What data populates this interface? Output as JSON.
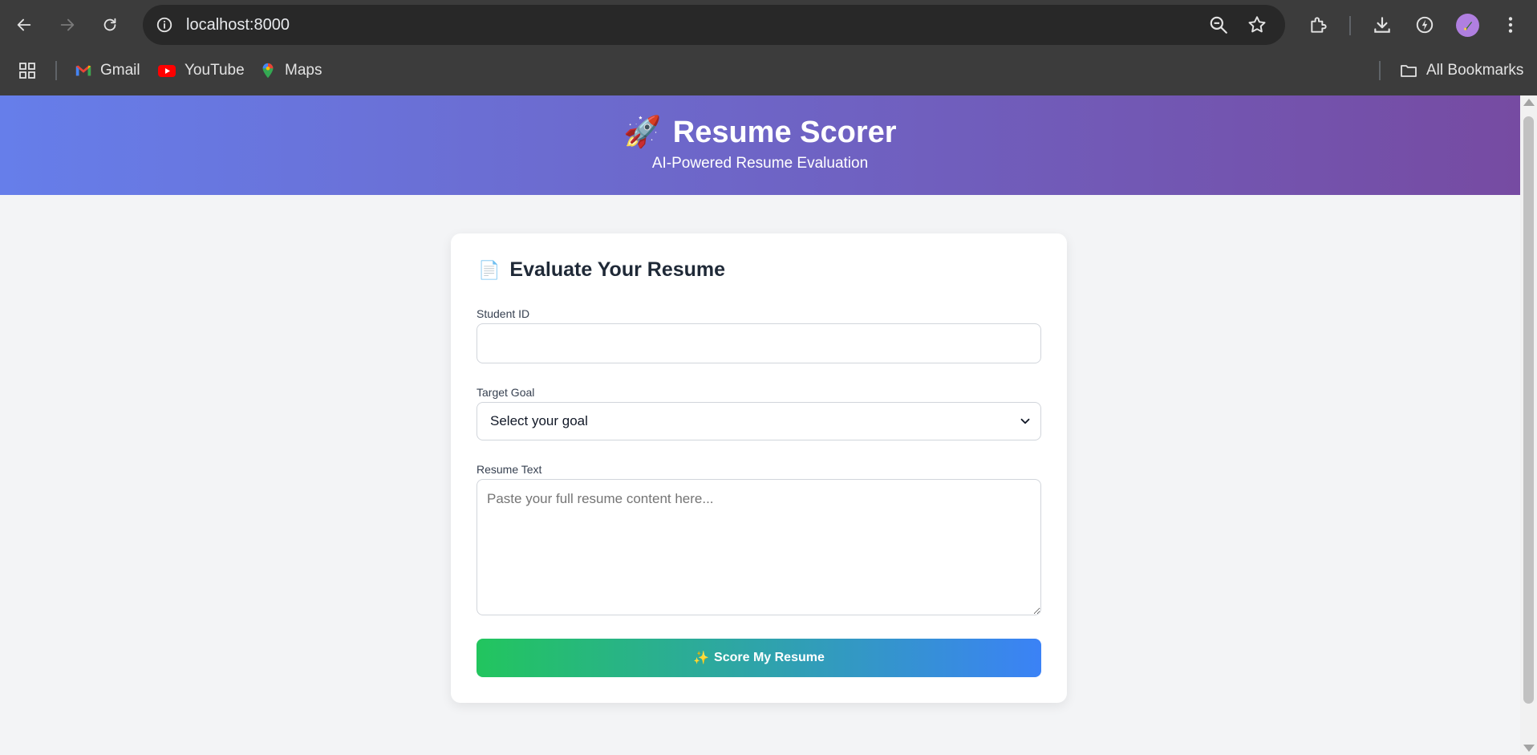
{
  "browser": {
    "url": "localhost:8000",
    "bookmarks": [
      {
        "label": "Gmail",
        "icon": "gmail-icon"
      },
      {
        "label": "YouTube",
        "icon": "youtube-icon"
      },
      {
        "label": "Maps",
        "icon": "maps-icon"
      }
    ],
    "all_bookmarks_label": "All Bookmarks"
  },
  "header": {
    "emoji": "🚀",
    "title": "Resume Scorer",
    "subtitle": "AI-Powered Resume Evaluation"
  },
  "form": {
    "emoji": "📄",
    "title": "Evaluate Your Resume",
    "student_id_label": "Student ID",
    "student_id_value": "",
    "goal_label": "Target Goal",
    "goal_selected": "Select your goal",
    "resume_label": "Resume Text",
    "resume_placeholder": "Paste your full resume content here...",
    "submit_emoji": "✨",
    "submit_label": "Score My Resume"
  },
  "colors": {
    "header_gradient_start": "#667eea",
    "header_gradient_end": "#764ba2",
    "button_gradient_start": "#22c55e",
    "button_gradient_end": "#3b82f6"
  }
}
